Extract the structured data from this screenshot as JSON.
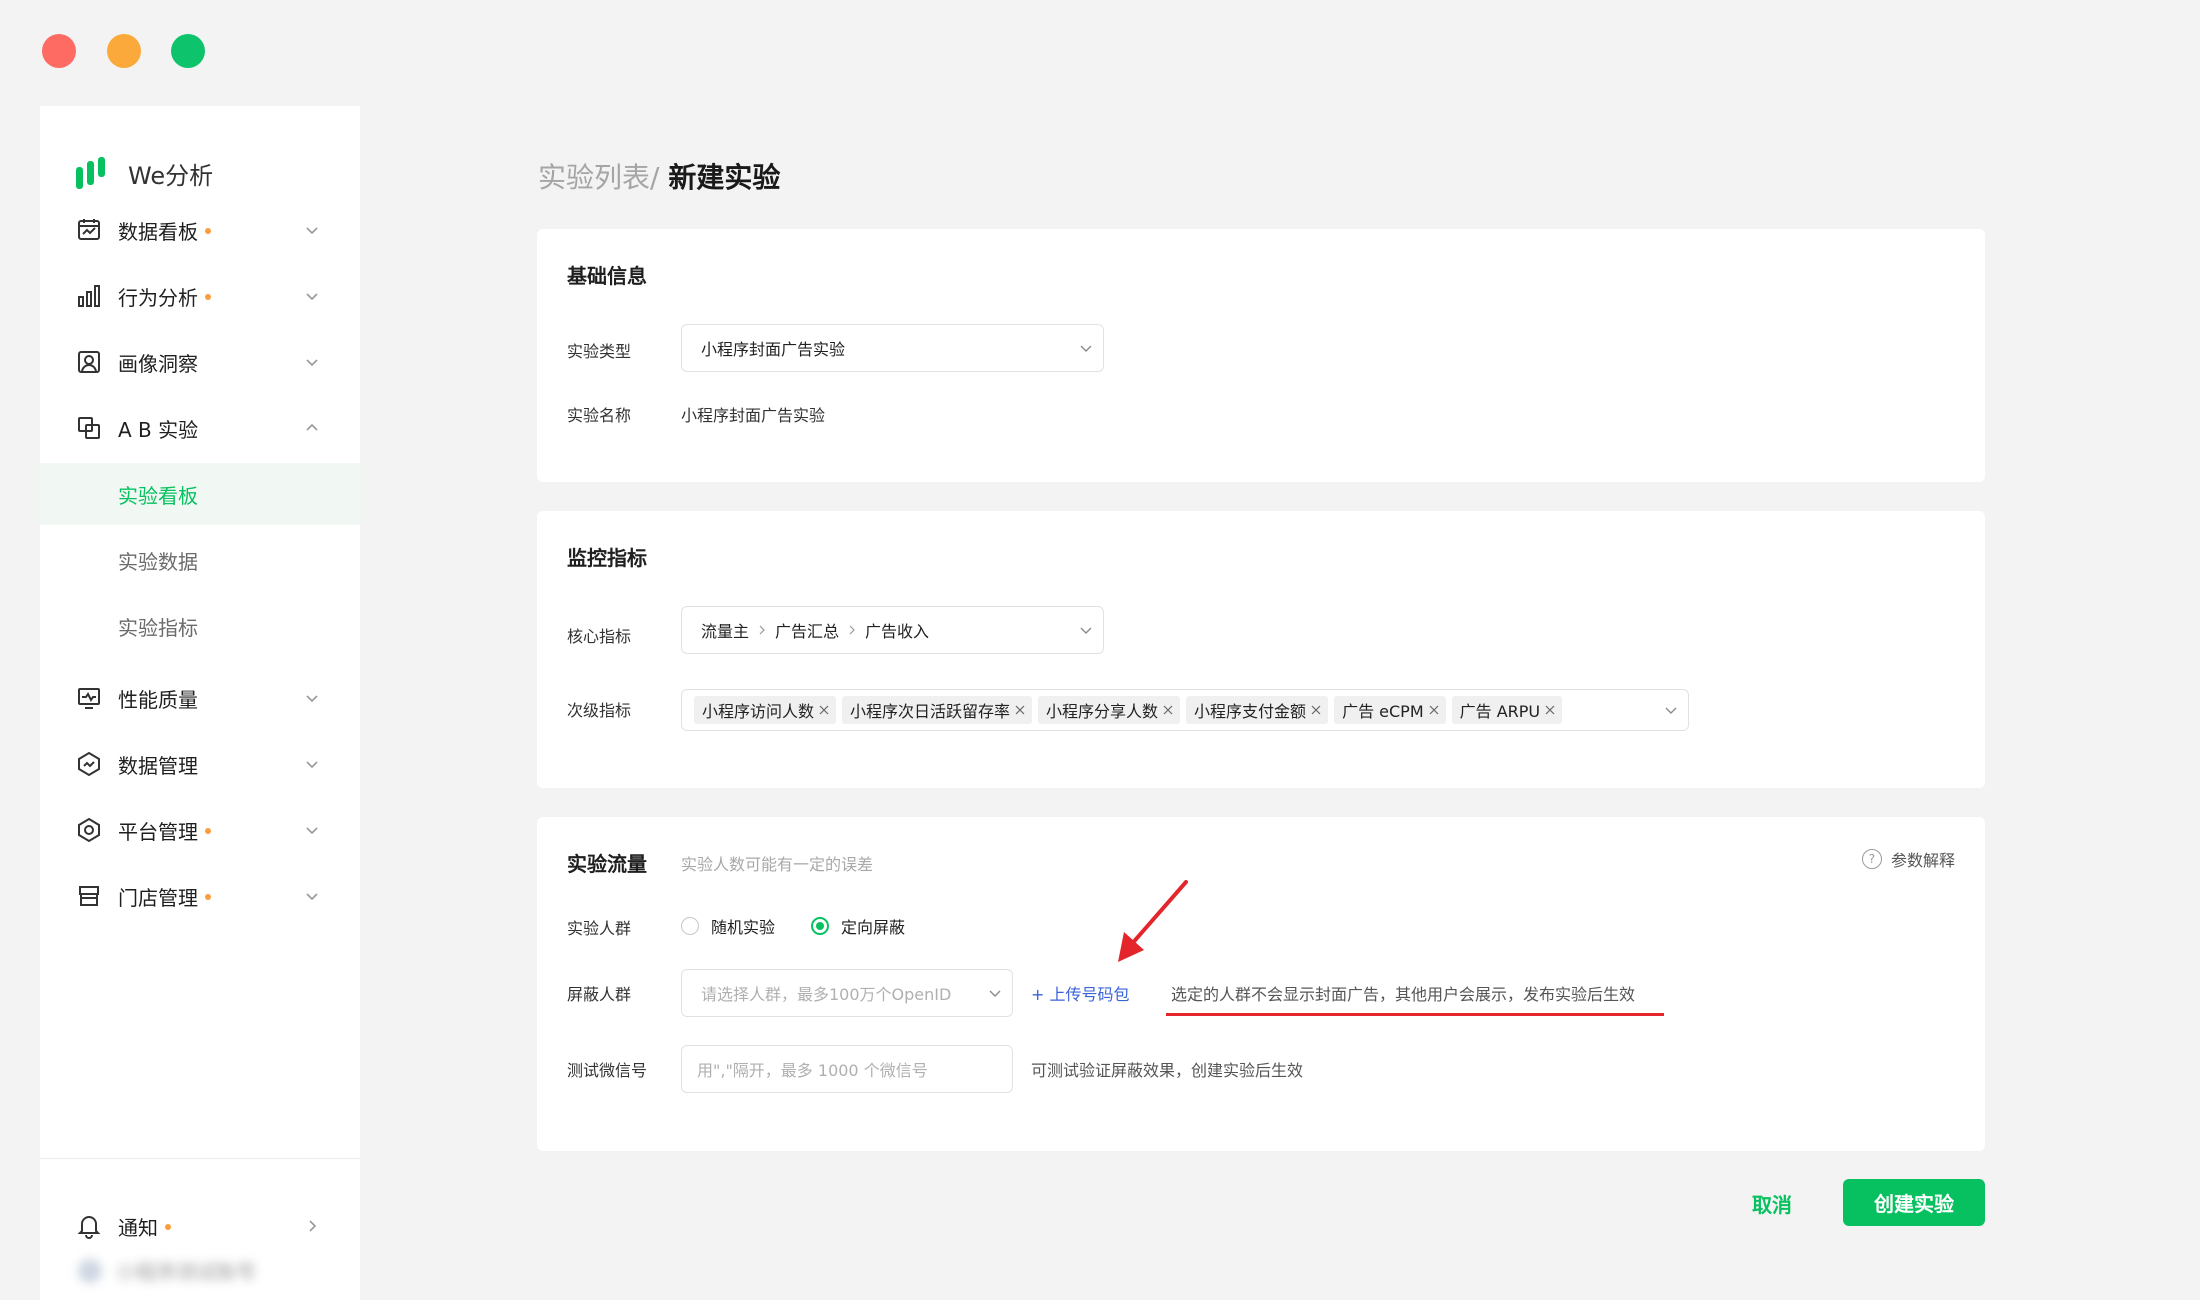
{
  "app": {
    "name": "We分析"
  },
  "sidebar": {
    "items": [
      {
        "label": "数据看板",
        "badge": true
      },
      {
        "label": "行为分析",
        "badge": true
      },
      {
        "label": "画像洞察",
        "badge": false
      },
      {
        "label": "A B 实验",
        "badge": false,
        "expanded": true,
        "children": [
          {
            "label": "实验看板",
            "active": true
          },
          {
            "label": "实验数据",
            "active": false
          },
          {
            "label": "实验指标",
            "active": false
          }
        ]
      },
      {
        "label": "性能质量",
        "badge": false
      },
      {
        "label": "数据管理",
        "badge": false
      },
      {
        "label": "平台管理",
        "badge": true
      },
      {
        "label": "门店管理",
        "badge": true
      }
    ],
    "notification": {
      "label": "通知",
      "badge": true
    },
    "account": {
      "label": "小程序测试账号"
    }
  },
  "breadcrumb": {
    "parent": "实验列表",
    "separator": "/ ",
    "current": "新建实验"
  },
  "basic_info": {
    "title": "基础信息",
    "type_label": "实验类型",
    "type_value": "小程序封面广告实验",
    "name_label": "实验名称",
    "name_value": "小程序封面广告实验"
  },
  "metrics": {
    "title": "监控指标",
    "core_label": "核心指标",
    "core_path": [
      "流量主",
      "广告汇总",
      "广告收入"
    ],
    "secondary_label": "次级指标",
    "secondary_tags": [
      "小程序访问人数",
      "小程序次日活跃留存率",
      "小程序分享人数",
      "小程序支付金额",
      "广告 eCPM",
      "广告 ARPU"
    ]
  },
  "traffic": {
    "title": "实验流量",
    "subtitle": "实验人数可能有一定的误差",
    "help_icon": "?",
    "help_label": "参数解释",
    "audience_label": "实验人群",
    "audience_options": [
      {
        "label": "随机实验",
        "checked": false
      },
      {
        "label": "定向屏蔽",
        "checked": true
      }
    ],
    "block_label": "屏蔽人群",
    "block_placeholder": "请选择人群，最多100万个OpenID",
    "upload_link": "+ 上传号码包",
    "block_hint": "选定的人群不会显示封面广告，其他用户会展示，发布实验后生效",
    "test_label": "测试微信号",
    "test_placeholder": "用\",\"隔开，最多 1000 个微信号",
    "test_hint": "可测试验证屏蔽效果，创建实验后生效"
  },
  "actions": {
    "cancel": "取消",
    "create": "创建实验"
  },
  "colors": {
    "brand": "#07c160",
    "accent_dot": "#fa9d3b",
    "link": "#3a63d8",
    "annotation": "#e4252b"
  }
}
